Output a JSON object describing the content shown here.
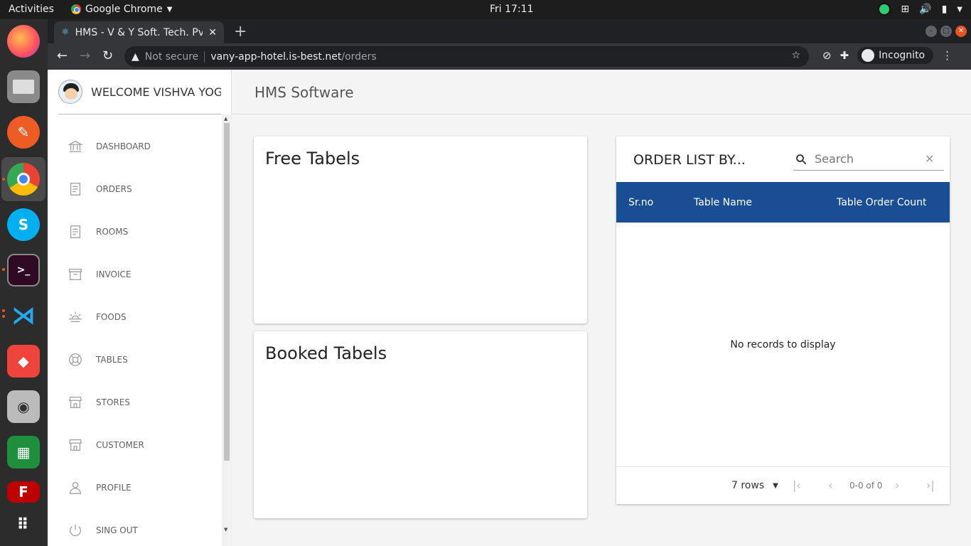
{
  "system": {
    "activities": "Activities",
    "app_name": "Google Chrome",
    "clock": "Fri 17:11"
  },
  "browser": {
    "tab_title": "HMS - V & Y Soft. Tech. Pvt",
    "security_label": "Not secure",
    "url_host": "vany-app-hotel.is-best.net",
    "url_path": "/orders",
    "incognito_label": "Incognito"
  },
  "sidebar": {
    "welcome": "WELCOME VISHVA YOGESH",
    "items": [
      {
        "label": "DASHBOARD",
        "icon": "bank-icon"
      },
      {
        "label": "ORDERS",
        "icon": "receipt-icon"
      },
      {
        "label": "ROOMS",
        "icon": "receipt-icon"
      },
      {
        "label": "INVOICE",
        "icon": "archive-icon"
      },
      {
        "label": "FOODS",
        "icon": "sunrise-icon"
      },
      {
        "label": "TABLES",
        "icon": "lifebuoy-icon"
      },
      {
        "label": "STORES",
        "icon": "store-icon"
      },
      {
        "label": "CUSTOMER",
        "icon": "store-icon"
      },
      {
        "label": "PROFILE",
        "icon": "user-icon"
      },
      {
        "label": "SING OUT",
        "icon": "power-icon"
      }
    ]
  },
  "header": {
    "title": "HMS Software"
  },
  "free_tables": {
    "title": "Free Tabels"
  },
  "booked_tables": {
    "title": "Booked Tabels"
  },
  "order_list": {
    "title": "ORDER LIST BY...",
    "search_placeholder": "Search",
    "columns": [
      "Sr.no",
      "Table Name",
      "Table Order Count"
    ],
    "empty_message": "No records to display",
    "rows_per_page": "7 rows",
    "page_info": "0-0 of 0"
  },
  "colors": {
    "table_header": "#1a4e94",
    "accent_orange": "#e95420"
  }
}
